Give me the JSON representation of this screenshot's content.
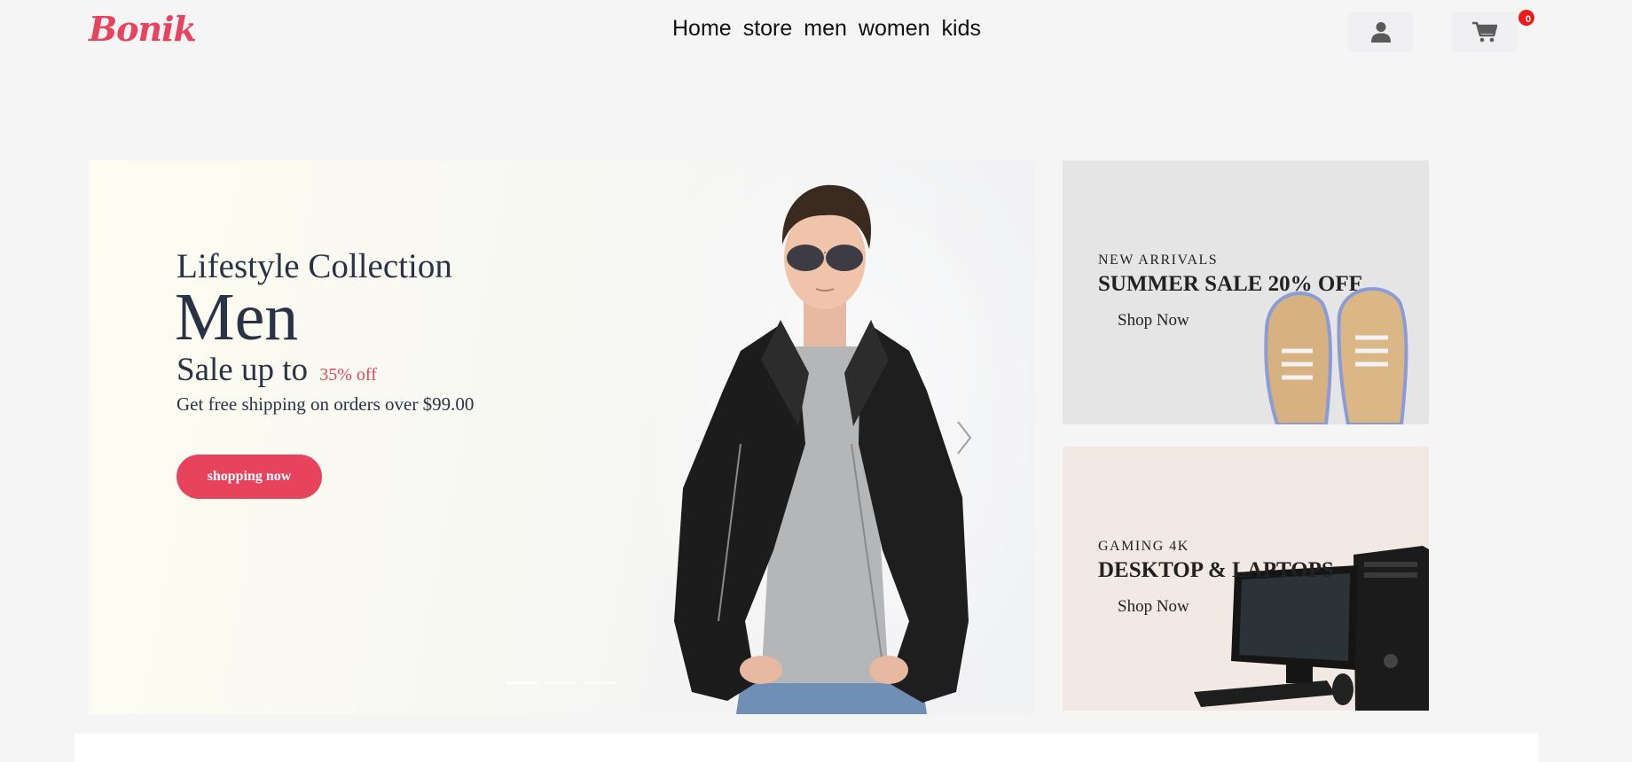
{
  "header": {
    "logo": "Bonik",
    "nav": [
      "Home",
      "store",
      "men",
      "women",
      "kids"
    ],
    "cart_count": "0"
  },
  "icons": {
    "user": "user-icon",
    "cart": "cart-icon",
    "hero_next": "chevron-right-icon"
  },
  "hero": {
    "subtitle": "Lifestyle Collection",
    "title": "Men",
    "sale_prefix": "Sale up to",
    "sale_discount": "35% off",
    "shipping": "Get free shipping on orders over $99.00",
    "cta": "shopping now",
    "slides_total": 3,
    "active_slide": 1
  },
  "promos": [
    {
      "kicker": "NEW ARRIVALS",
      "title": "SUMMER SALE 20% OFF",
      "link": "Shop Now",
      "bg": "#e5e5e5"
    },
    {
      "kicker": "GAMING 4K",
      "title": "DESKTOP & LAPTOPS",
      "link": "Shop Now",
      "bg": "#f2e9e5"
    }
  ],
  "colors": {
    "accent": "#e8435d",
    "badge": "#ef1a1a",
    "text": "#2a3345",
    "page_bg": "#f5f5f5"
  }
}
